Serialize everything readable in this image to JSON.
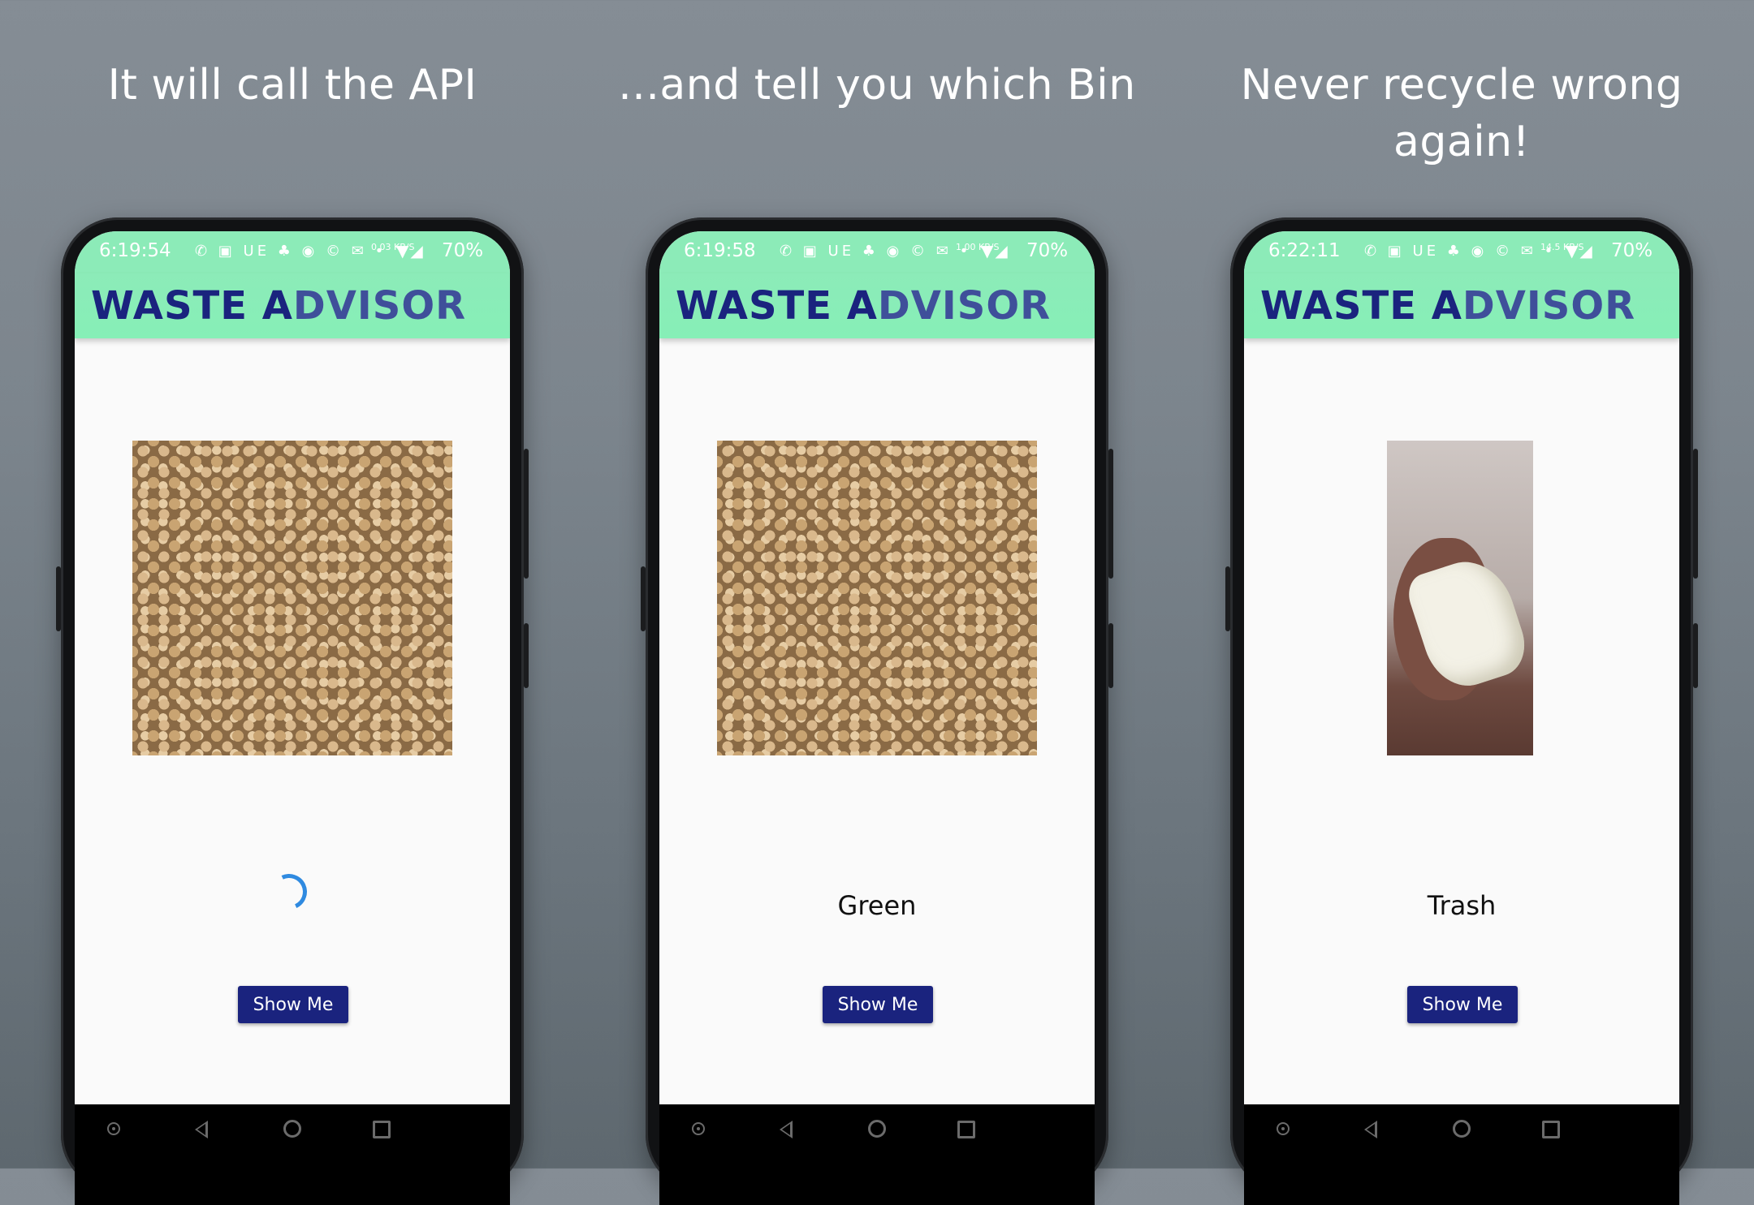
{
  "colors": {
    "status_bar": "#8cebb8",
    "app_bar": "#86efb7",
    "title_primary": "#1a237e",
    "title_secondary": "#3f4f9a",
    "button": "#1a237e",
    "spinner": "#2f8ae0",
    "screen_bg": "#fafafa"
  },
  "panels": [
    {
      "caption": "It will call the API",
      "status": {
        "time": "6:19:54",
        "speed": "0.03 KB/S",
        "battery": "70%"
      },
      "app_title_part1": "WASTE A",
      "app_title_part2": "DVISOR",
      "image": "chickpeas-photo",
      "result": "",
      "loading": true,
      "button_label": "Show Me"
    },
    {
      "caption": "...and tell you which Bin",
      "status": {
        "time": "6:19:58",
        "speed": "1.00 KB/S",
        "battery": "70%"
      },
      "app_title_part1": "WASTE A",
      "app_title_part2": "DVISOR",
      "image": "chickpeas-photo",
      "result": "Green",
      "loading": false,
      "button_label": "Show Me"
    },
    {
      "caption": "Never recycle wrong again!",
      "status": {
        "time": "6:22:11",
        "speed": "14.5 KB/S",
        "battery": "70%"
      },
      "app_title_part1": "WASTE A",
      "app_title_part2": "DVISOR",
      "image": "tissue-photo",
      "result": "Trash",
      "loading": false,
      "button_label": "Show Me"
    }
  ],
  "status_icons": "✆ ▣ UE ♣ ◉ © ✉ •",
  "status_signal": "▼◢",
  "nav_icons": [
    "assist-icon",
    "back-icon",
    "home-icon",
    "recents-icon"
  ]
}
